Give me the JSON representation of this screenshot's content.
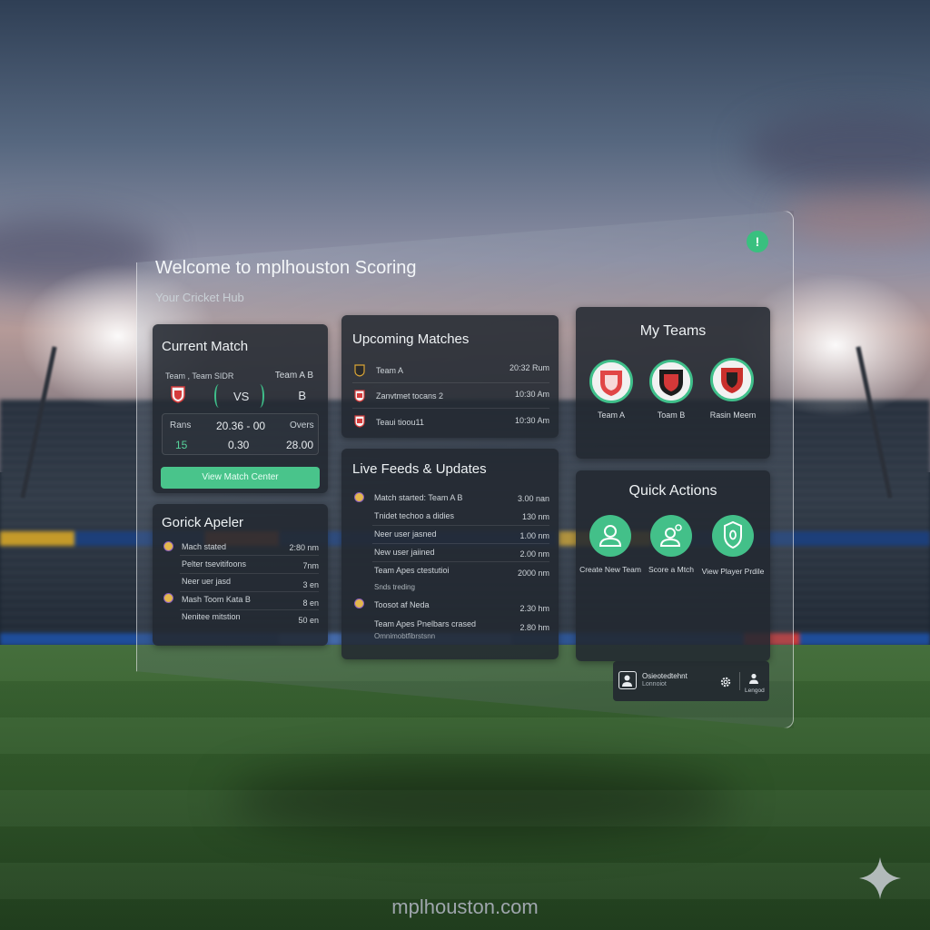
{
  "header": {
    "title": "Welcome to mplhouston Scoring",
    "subtitle": "Your Cricket Hub",
    "status_dot": "!"
  },
  "current_match": {
    "title": "Current Match",
    "team_a_label": "Team , Team SIDR",
    "team_b_label": "Team A B",
    "vs": "VS",
    "b": "B",
    "runs_label": "Rans",
    "runs_value": "20.36 - 00",
    "overs_label": "Overs",
    "left_value": "15",
    "mid_value": "0.30",
    "right_value": "28.00",
    "button_label": "View Match Center"
  },
  "activity": {
    "title": "Gorick Apeler",
    "items": [
      {
        "text": "Mach stated",
        "time": "2:80 nm",
        "icon": "avatar-icon"
      },
      {
        "text": "Pelter tsevitifoons",
        "time": "7nm",
        "icon": ""
      },
      {
        "text": "Neer uer jasd",
        "time": "3 en",
        "icon": ""
      },
      {
        "text": "Mash Toom Kata B",
        "time": "8 en",
        "icon": "avatar-icon"
      },
      {
        "text": "Nenitee mitstion",
        "time": "50 en",
        "icon": ""
      }
    ]
  },
  "upcoming": {
    "title": "Upcoming Matches",
    "items": [
      {
        "text": "Team A",
        "time": "20:32 Rum",
        "icon": "crest-icon-dark"
      },
      {
        "text": "Zanvtmet tocans 2",
        "time": "10:30 Am",
        "icon": "crest-icon-red"
      },
      {
        "text": "Teaui tioou11",
        "time": "10:30 Am",
        "icon": "crest-icon-red"
      }
    ]
  },
  "feeds": {
    "title": "Live Feeds & Updates",
    "items": [
      {
        "text": "Match started: Team A B",
        "time": "3.00 nan",
        "icon": "avatar-icon"
      },
      {
        "text": "Tnidet techoo a didies",
        "time": "130 nm",
        "icon": ""
      },
      {
        "text": "Neer user jasned",
        "time": "1.00 nm",
        "icon": ""
      },
      {
        "text": "New user jaiined",
        "time": "2.00 nm",
        "icon": ""
      },
      {
        "text": "Team Apes ctestutioi",
        "time": "2000 nm",
        "icon": ""
      },
      {
        "text": "Snds treding",
        "time": "",
        "icon": ""
      },
      {
        "text": "Toosot af Neda",
        "time": "2.30 hm",
        "icon": "avatar-icon"
      },
      {
        "text": "Team Apes Pnelbars crased",
        "time": "2.80 hm",
        "icon": ""
      },
      {
        "text": "Omnimobtfibrstsnn",
        "time": "",
        "icon": ""
      }
    ]
  },
  "my_teams": {
    "title": "My Teams",
    "teams": [
      {
        "label": "Team A",
        "icon": "team-a-crest-icon"
      },
      {
        "label": "Toam B",
        "icon": "team-b-crest-icon"
      },
      {
        "label": "Rasin Meem",
        "icon": "team-c-crest-icon"
      }
    ]
  },
  "quick_actions": {
    "title": "Quick Actions",
    "actions": [
      {
        "label": "Create New Team",
        "icon": "user-icon"
      },
      {
        "label": "Score a Mtch",
        "icon": "score-user-icon"
      },
      {
        "label": "View Player Prdile",
        "icon": "shield-icon"
      }
    ]
  },
  "user_bar": {
    "name": "Osieotedtehnt",
    "status": "Lonnoiot",
    "profile_label": "Lengod"
  },
  "footer": {
    "url": "mplhouston.com"
  },
  "colors": {
    "accent": "#43c089",
    "card": "#22282f",
    "text": "#e8ecef"
  }
}
